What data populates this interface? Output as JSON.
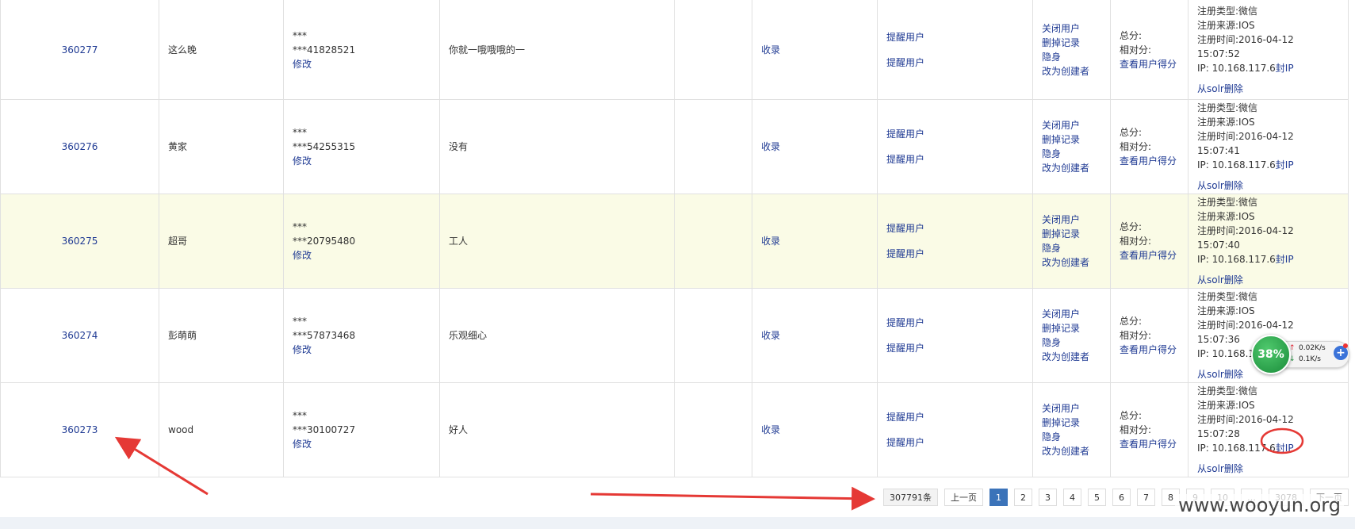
{
  "rows": [
    {
      "id": "360277",
      "nick": "这么晚",
      "pwd": "***",
      "phone": "***41828521",
      "edit": "修改",
      "sign": "你就一哦哦哦的一",
      "collect": "收录",
      "remind1": "提醒用户",
      "remind2": "提醒用户",
      "close": "关闭用户",
      "del": "删掉记录",
      "hide": "隐身",
      "creator": "改为创建者",
      "total": "总分:",
      "relative": "相对分:",
      "score": "查看用户得分",
      "reg_type": "注册类型:微信",
      "reg_src": "注册来源:IOS",
      "reg_time": "注册时间:2016-04-12 15:07:52",
      "ip": "IP: 10.168.117.6",
      "ban": "封IP",
      "solr": "从solr删除"
    },
    {
      "id": "360276",
      "nick": "黄家",
      "pwd": "***",
      "phone": "***54255315",
      "edit": "修改",
      "sign": "没有",
      "collect": "收录",
      "remind1": "提醒用户",
      "remind2": "提醒用户",
      "close": "关闭用户",
      "del": "删掉记录",
      "hide": "隐身",
      "creator": "改为创建者",
      "total": "总分:",
      "relative": "相对分:",
      "score": "查看用户得分",
      "reg_type": "注册类型:微信",
      "reg_src": "注册来源:IOS",
      "reg_time": "注册时间:2016-04-12 15:07:41",
      "ip": "IP: 10.168.117.6",
      "ban": "封IP",
      "solr": "从solr删除"
    },
    {
      "id": "360275",
      "nick": "超哥",
      "pwd": "***",
      "phone": "***20795480",
      "edit": "修改",
      "sign": "工人",
      "collect": "收录",
      "remind1": "提醒用户",
      "remind2": "提醒用户",
      "close": "关闭用户",
      "del": "删掉记录",
      "hide": "隐身",
      "creator": "改为创建者",
      "total": "总分:",
      "relative": "相对分:",
      "score": "查看用户得分",
      "reg_type": "注册类型:微信",
      "reg_src": "注册来源:IOS",
      "reg_time": "注册时间:2016-04-12 15:07:40",
      "ip": "IP: 10.168.117.6",
      "ban": "封IP",
      "solr": "从solr删除"
    },
    {
      "id": "360274",
      "nick": "彭萌萌",
      "pwd": "***",
      "phone": "***57873468",
      "edit": "修改",
      "sign": "乐观细心",
      "collect": "收录",
      "remind1": "提醒用户",
      "remind2": "提醒用户",
      "close": "关闭用户",
      "del": "删掉记录",
      "hide": "隐身",
      "creator": "改为创建者",
      "total": "总分:",
      "relative": "相对分:",
      "score": "查看用户得分",
      "reg_type": "注册类型:微信",
      "reg_src": "注册来源:IOS",
      "reg_time": "注册时间:2016-04-12 15:07:36",
      "ip": "IP: 10.168.1",
      "ban": "",
      "solr": "从solr删除"
    },
    {
      "id": "360273",
      "nick": "wood",
      "pwd": "***",
      "phone": "***30100727",
      "edit": "修改",
      "sign": "好人",
      "collect": "收录",
      "remind1": "提醒用户",
      "remind2": "提醒用户",
      "close": "关闭用户",
      "del": "删掉记录",
      "hide": "隐身",
      "creator": "改为创建者",
      "total": "总分:",
      "relative": "相对分:",
      "score": "查看用户得分",
      "reg_type": "注册类型:微信",
      "reg_src": "注册来源:IOS",
      "reg_time": "注册时间:2016-04-12 15:07:28",
      "ip": "IP: 10.168.117.6",
      "ban": "封IP",
      "solr": "从solr删除"
    }
  ],
  "pager": {
    "total": "307791条",
    "prev": "上一页",
    "pages": [
      "1",
      "2",
      "3",
      "4",
      "5",
      "6",
      "7",
      "8",
      "9",
      "10"
    ],
    "last": "3078",
    "next": "下一页",
    "active": "1"
  },
  "netwidget": {
    "percent": "38%",
    "up": "0.02K/s",
    "down": "0.1K/s",
    "up_arrow": "↑",
    "down_arrow": "↓",
    "plus": "+"
  },
  "watermark": "www.wooyun.org",
  "colors": {
    "link": "#1f3a93",
    "highlight_row": "#fafbe6",
    "active_page": "#3b73b9",
    "annotation": "#e53935",
    "widget_green": "#1a8c3a"
  }
}
